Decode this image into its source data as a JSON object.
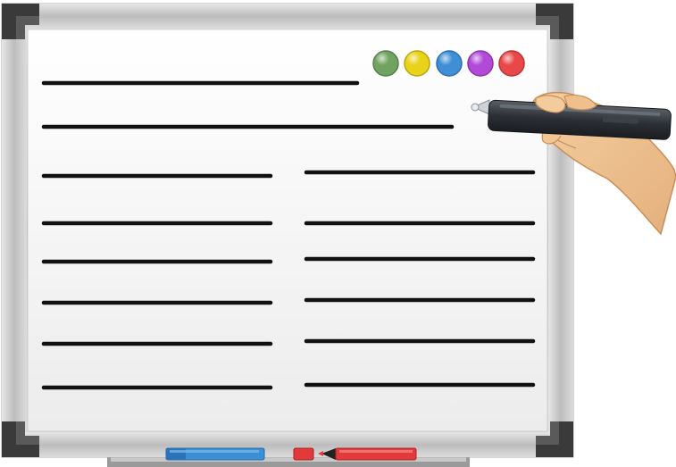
{
  "board": {
    "frame_color": "#c8c8c8",
    "surface_color": "#f4f4f4",
    "corner_color": "#3a3a3a"
  },
  "palette": {
    "colors": [
      {
        "name": "green",
        "hex": "#6fa35f"
      },
      {
        "name": "yellow",
        "hex": "#e8d21a"
      },
      {
        "name": "blue",
        "hex": "#3e8fd6"
      },
      {
        "name": "purple",
        "hex": "#b24ad8"
      },
      {
        "name": "red",
        "hex": "#e84848"
      }
    ]
  },
  "markers": [
    {
      "name": "blue-marker",
      "hex": "#3a8fd6"
    },
    {
      "name": "red-marker",
      "hex": "#e23a3a"
    }
  ],
  "stylus": {
    "icon": "stylus-pen-icon",
    "hand_icon": "hand-icon"
  }
}
